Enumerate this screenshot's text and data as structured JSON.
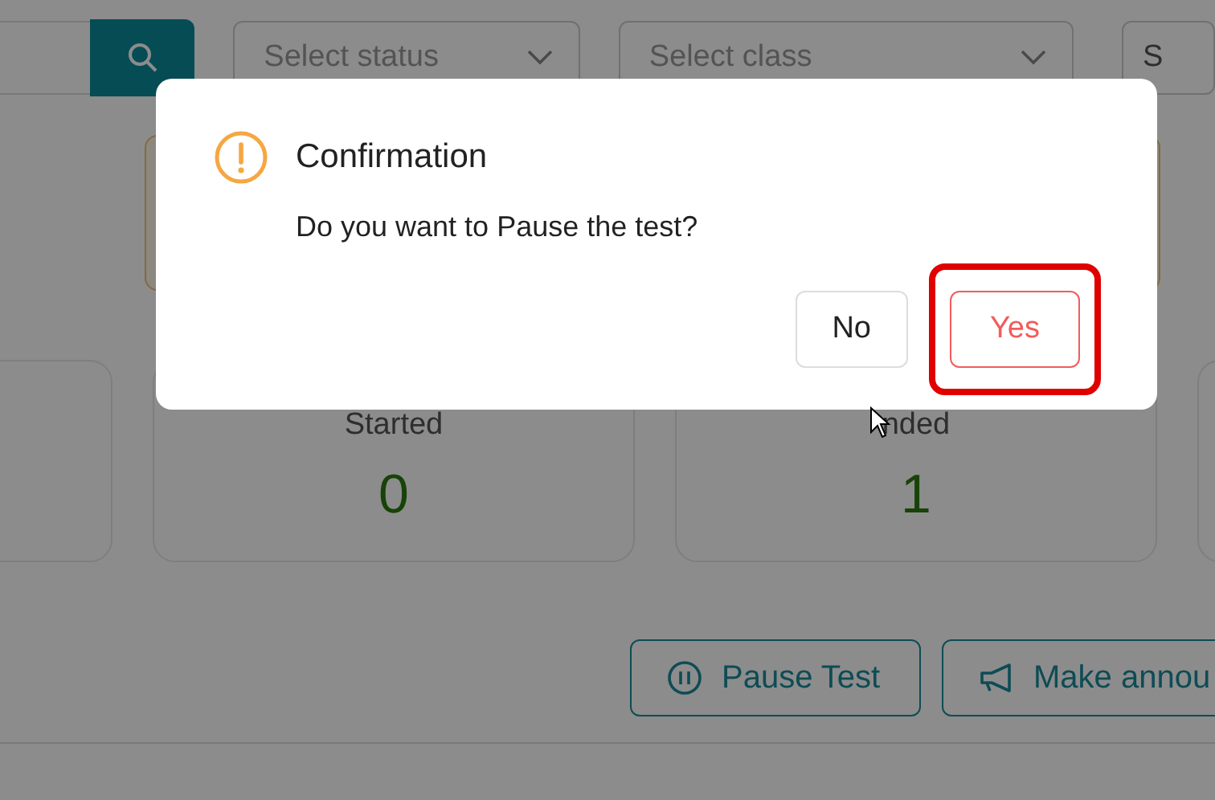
{
  "filters": {
    "status": {
      "placeholder": "Select status"
    },
    "class": {
      "placeholder": "Select class"
    },
    "cut_button": "S"
  },
  "stat_cards": [
    {
      "label": "Started",
      "value": "0"
    },
    {
      "label": "nded",
      "value": "1"
    }
  ],
  "actions": [
    {
      "label": "Pause Test",
      "kind": "pause"
    },
    {
      "label": "Make annou",
      "kind": "announce"
    }
  ],
  "dialog": {
    "title": "Confirmation",
    "message": "Do you want to Pause the test?",
    "buttons": [
      {
        "label": "No",
        "kind": "default",
        "highlighted": false
      },
      {
        "label": "Yes",
        "kind": "danger",
        "highlighted": true
      }
    ]
  }
}
